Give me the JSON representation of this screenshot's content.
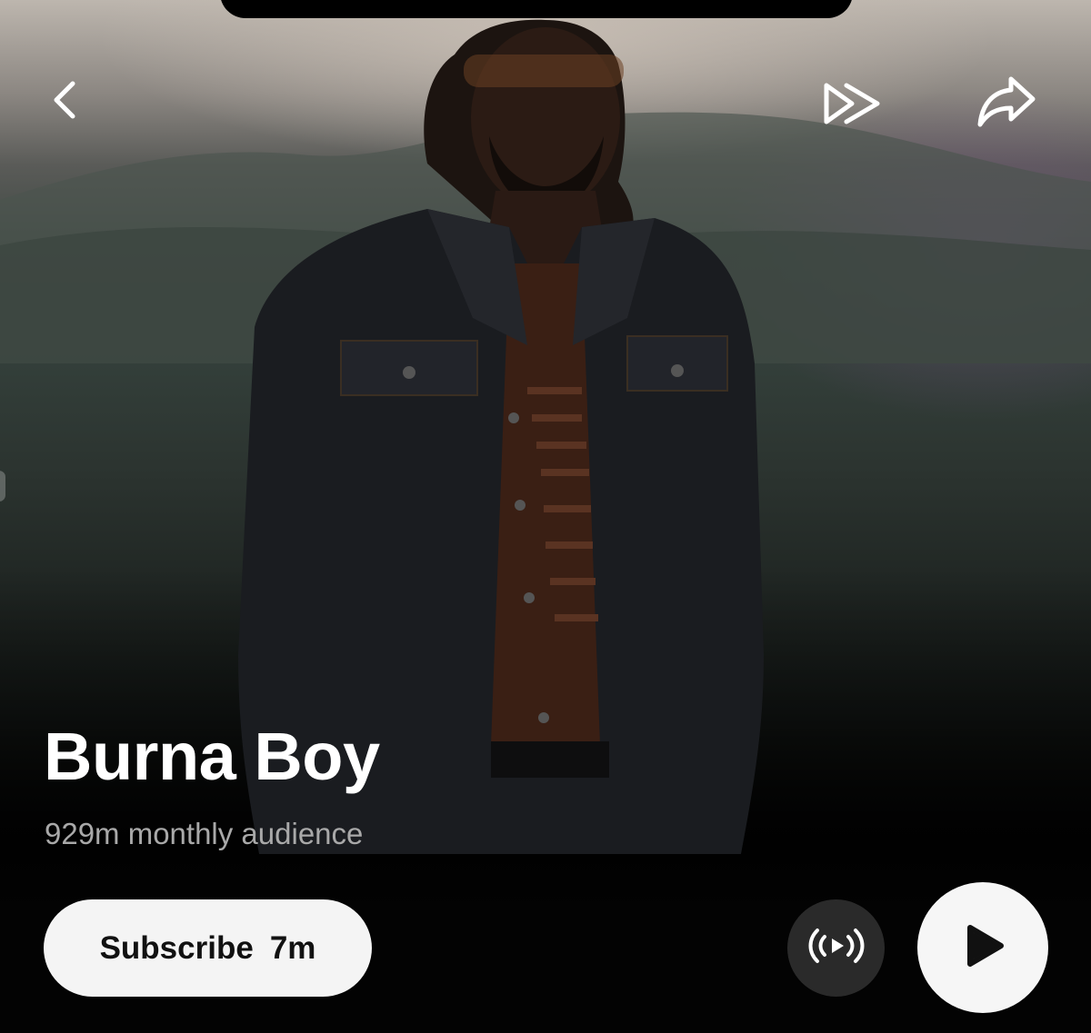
{
  "artist": {
    "name": "Burna Boy",
    "audience": "929m monthly audience"
  },
  "actions": {
    "subscribe_label": "Subscribe",
    "subscribe_count": "7m"
  },
  "icons": {
    "back": "chevron-left-icon",
    "skip": "double-chevron-right-icon",
    "share": "share-arrow-icon",
    "radio": "radio-broadcast-icon",
    "play": "play-icon"
  },
  "colors": {
    "background": "#030303",
    "primary_button": "#f4f4f4",
    "secondary_button": "#2a2a2a",
    "subtitle": "#a9a9a9"
  }
}
